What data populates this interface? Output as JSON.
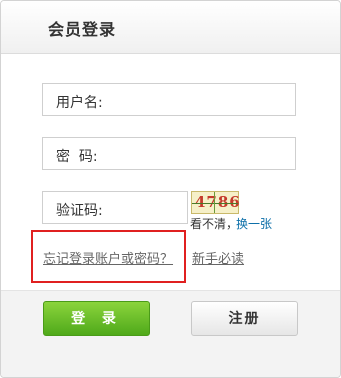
{
  "header": {
    "title": "会员登录"
  },
  "form": {
    "username_label": "用户名:",
    "password_label": "密  码:",
    "captcha_label": "验证码:",
    "username_value": "",
    "password_value": "",
    "captcha_value": ""
  },
  "captcha": {
    "image_text": "4786",
    "unclear_text": "看不清，",
    "refresh_link": "换一张"
  },
  "links": {
    "forgot": "忘记登录账户或密码？",
    "guide": "新手必读"
  },
  "buttons": {
    "login": "登 录",
    "register": "注册"
  },
  "colors": {
    "login_button": "#5cb822",
    "highlight_border": "#e02020",
    "link_blue": "#0a6ea8"
  }
}
